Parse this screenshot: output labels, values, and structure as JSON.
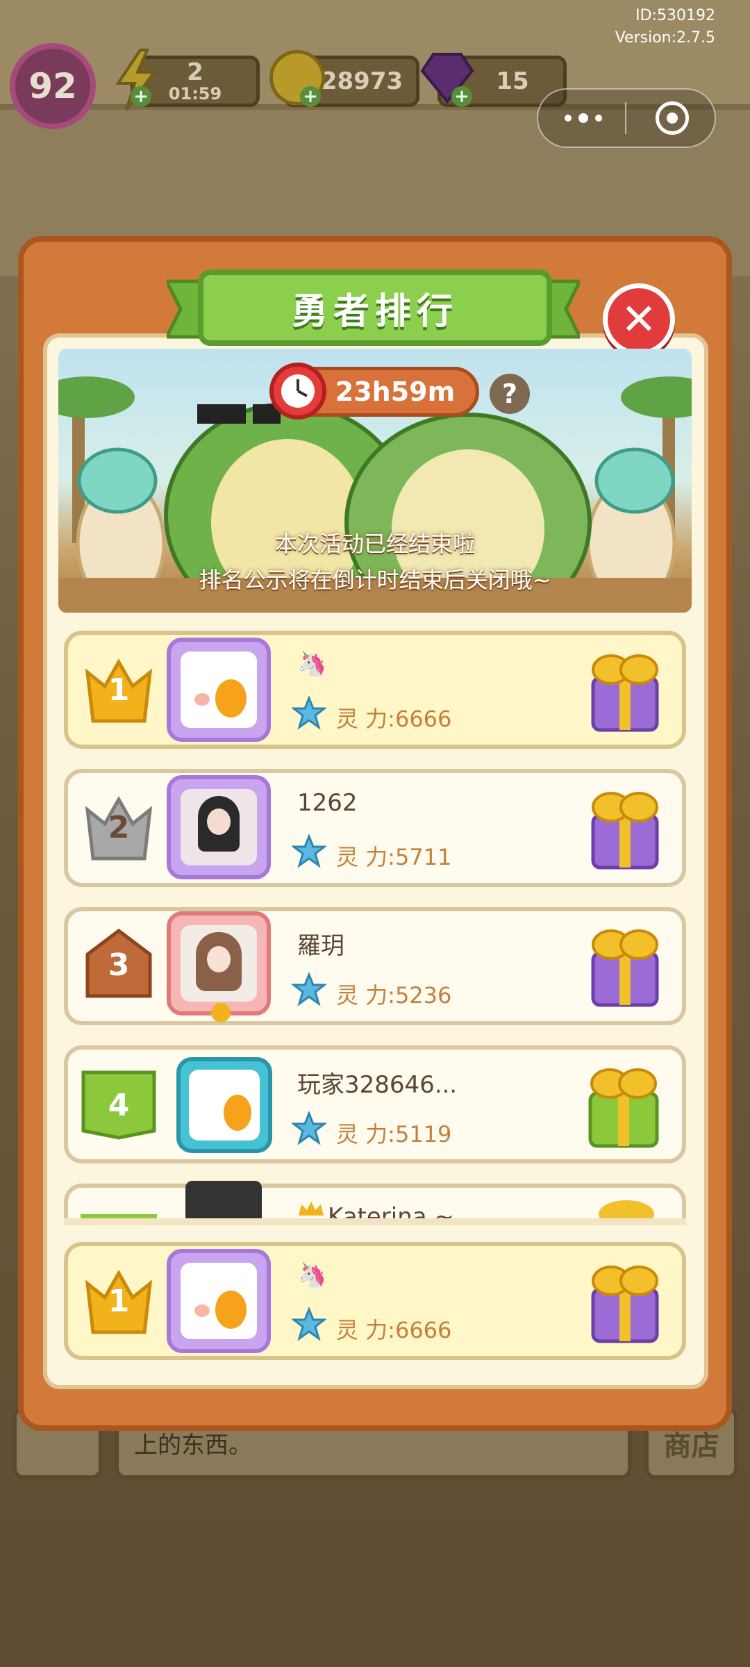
{
  "system": {
    "id_text": "ID:530192",
    "version_text": "Version:2.7.5"
  },
  "hud": {
    "level": "92",
    "energy_value": "2",
    "energy_timer": "01:59",
    "coins": "28973",
    "gems": "15"
  },
  "modal": {
    "title": "勇者排行",
    "timer": "23h59m",
    "help_label": "?",
    "close_label": "✕",
    "notice_line1": "本次活动已经结束啦",
    "notice_line2": "排名公示将在倒计时结束后关闭哦~"
  },
  "rankings": [
    {
      "rank": "1",
      "name": "🦄",
      "power": "灵 力:6666"
    },
    {
      "rank": "2",
      "name": "1262",
      "power": "灵 力:5711"
    },
    {
      "rank": "3",
      "name": "羅玥",
      "power": "灵 力:5236"
    },
    {
      "rank": "4",
      "name": "玩家328646...",
      "power": "灵 力:5119"
    },
    {
      "rank": "",
      "name": "Katerina ~",
      "power": ""
    }
  ],
  "my_rank": {
    "rank": "1",
    "name": "🦄",
    "power": "灵 力:6666"
  },
  "background": {
    "dialog_text": "上的东西。",
    "shop_label": "商店"
  },
  "colors": {
    "modal_orange": "#d27a3a",
    "title_green": "#8ccf4e",
    "close_red": "#e23b3b",
    "gold": "#f2b21b",
    "silver": "#a8a8a8",
    "bronze": "#c06a3a",
    "green_badge": "#8cc83c"
  }
}
